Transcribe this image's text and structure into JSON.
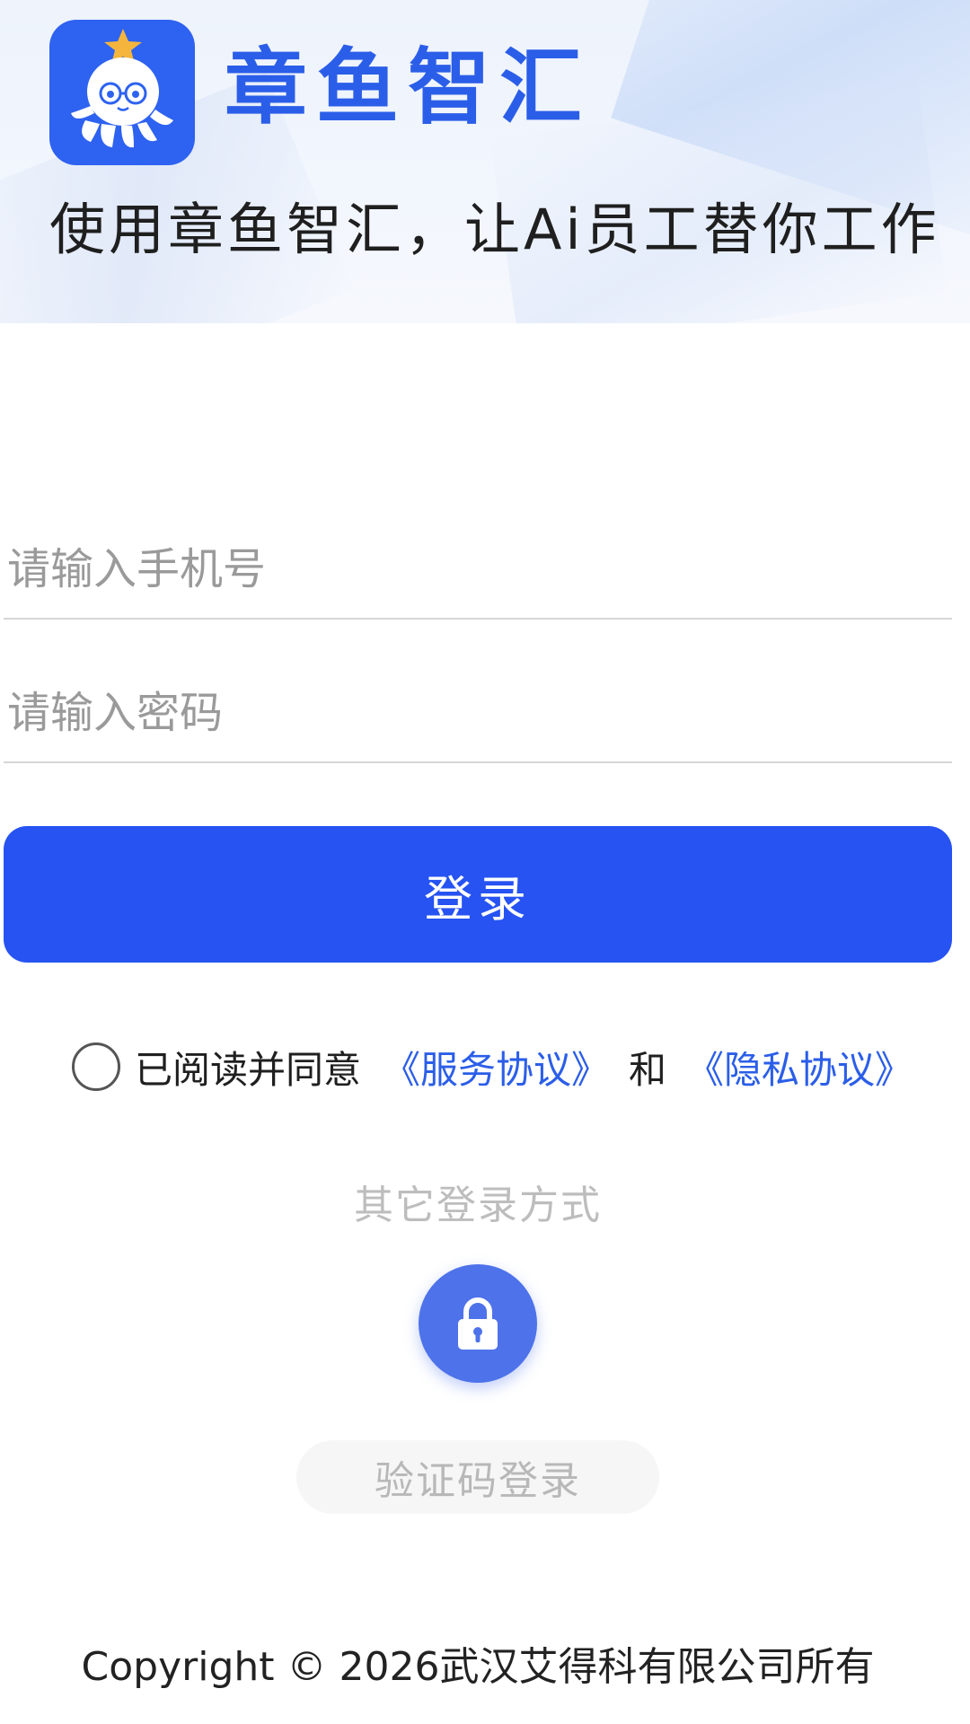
{
  "header": {
    "app_name": "章鱼智汇",
    "slogan": "使用章鱼智汇，让Ai员工替你工作"
  },
  "form": {
    "phone_placeholder": "请输入手机号",
    "password_placeholder": "请输入密码",
    "login_label": "登录"
  },
  "agreement": {
    "prefix": "已阅读并同意",
    "service_link": "《服务协议》",
    "conjunction": "和",
    "privacy_link": "《隐私协议》",
    "checked": false
  },
  "other_login": {
    "title": "其它登录方式",
    "icon": "lock-icon",
    "code_login_label": "验证码登录"
  },
  "footer": {
    "copyright": "Copyright © 2026武汉艾得科有限公司所有"
  },
  "colors": {
    "brand": "#2b5ee8",
    "button": "#2653f2",
    "lock_button": "#4d72ea"
  }
}
